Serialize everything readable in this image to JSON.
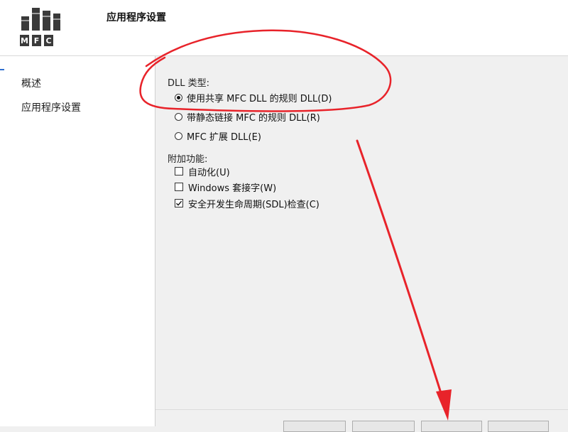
{
  "header": {
    "title": "应用程序设置"
  },
  "logo": {
    "letters": [
      "M",
      "F",
      "C"
    ]
  },
  "sidebar": {
    "items": [
      {
        "label": "概述"
      },
      {
        "label": "应用程序设置"
      }
    ]
  },
  "dll_type": {
    "label": "DLL 类型:",
    "options": [
      {
        "label": "使用共享 MFC DLL 的规则 DLL(D)",
        "selected": true
      },
      {
        "label": "带静态链接 MFC 的规则 DLL(R)",
        "selected": false
      },
      {
        "label": "MFC 扩展 DLL(E)",
        "selected": false
      }
    ]
  },
  "extra_features": {
    "label": "附加功能:",
    "options": [
      {
        "label": "自动化(U)",
        "checked": false
      },
      {
        "label": "Windows 套接字(W)",
        "checked": false
      },
      {
        "label": "安全开发生命周期(SDL)检查(C)",
        "checked": true
      }
    ]
  },
  "colors": {
    "annotation": "#e8232a",
    "accent": "#2f6fcf"
  }
}
